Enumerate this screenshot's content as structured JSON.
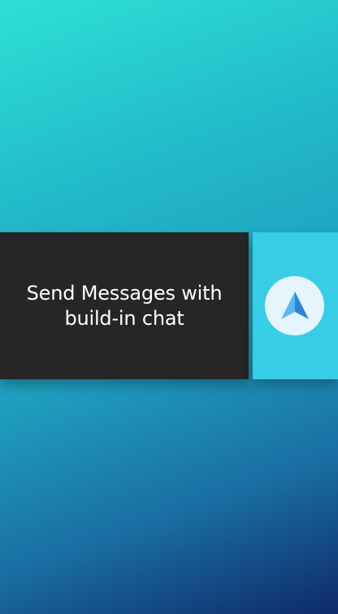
{
  "banner": {
    "line1": "Send Messages with",
    "line2": "build-in chat"
  },
  "send_icon": {
    "name": "send-icon",
    "colors": {
      "light": "#5ab8ef",
      "dark": "#2d84d8",
      "circle": "#e6f4fb",
      "panel": "#38cde6"
    }
  }
}
